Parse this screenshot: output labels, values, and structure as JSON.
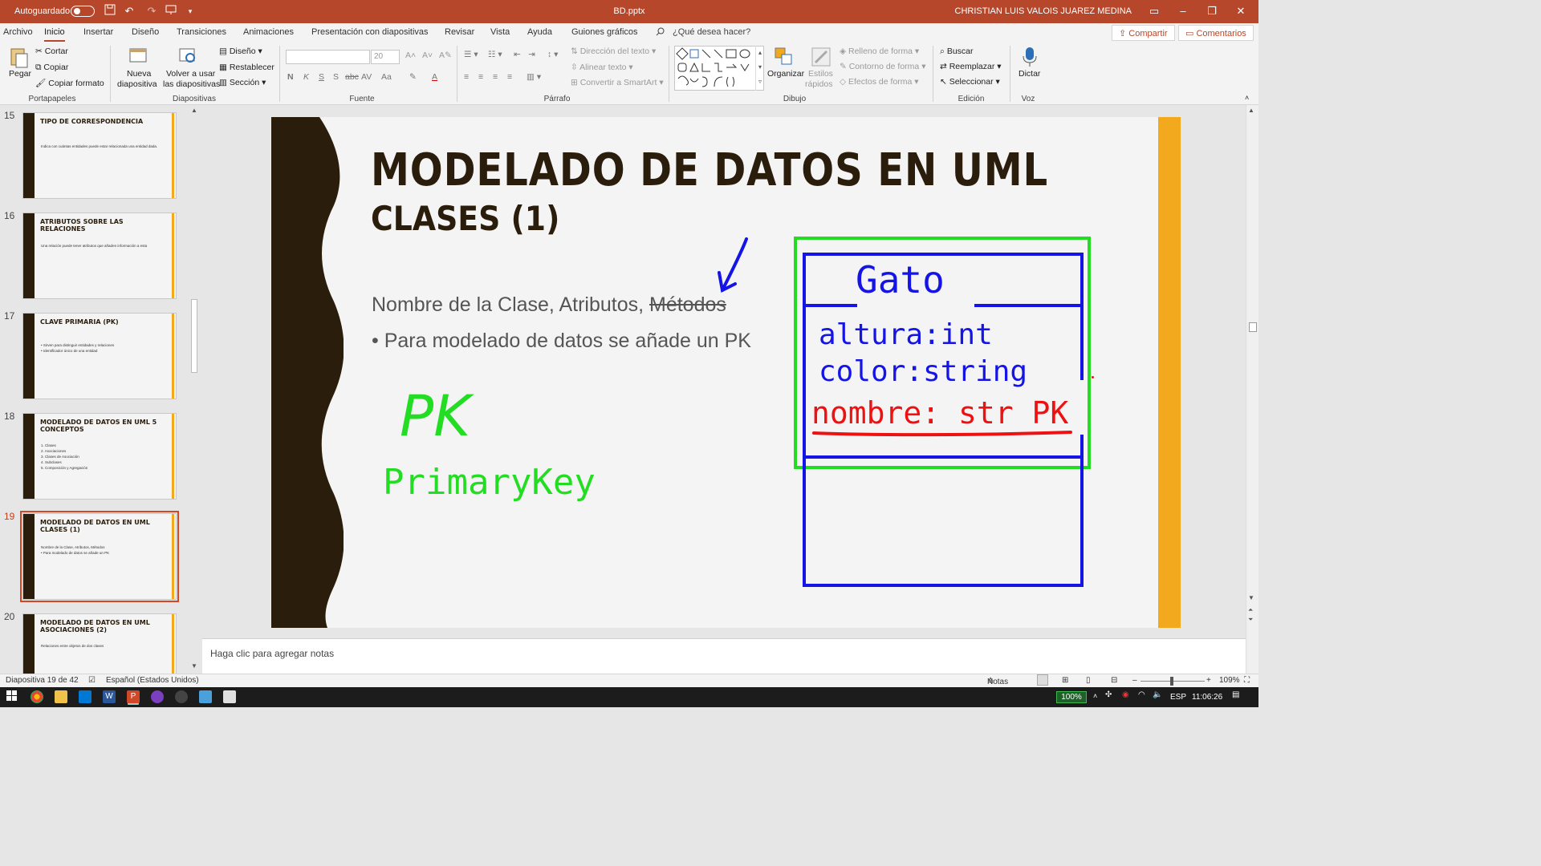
{
  "titlebar": {
    "autosave_label": "Autoguardado",
    "document_name": "BD.pptx",
    "user_name": "CHRISTIAN LUIS VALOIS JUAREZ MEDINA"
  },
  "tabs": [
    "Archivo",
    "Inicio",
    "Insertar",
    "Diseño",
    "Transiciones",
    "Animaciones",
    "Presentación con diapositivas",
    "Revisar",
    "Vista",
    "Ayuda",
    "Guiones gráficos"
  ],
  "tell_me": "¿Qué desea hacer?",
  "share_label": "Compartir",
  "comments_label": "Comentarios",
  "ribbon": {
    "portapapeles": {
      "label": "Portapapeles",
      "paste": "Pegar",
      "cut": "Cortar",
      "copy": "Copiar",
      "format_painter": "Copiar formato"
    },
    "diapositivas": {
      "label": "Diapositivas",
      "new_slide_1": "Nueva",
      "new_slide_2": "diapositiva",
      "reuse_1": "Volver a usar",
      "reuse_2": "las diapositivas",
      "layout": "Diseño",
      "reset": "Restablecer",
      "section": "Sección"
    },
    "fuente": {
      "label": "Fuente",
      "size": "20"
    },
    "parrafo": {
      "label": "Párrafo",
      "text_direction": "Dirección del texto",
      "align_text": "Alinear texto",
      "smartart": "Convertir a SmartArt"
    },
    "dibujo": {
      "label": "Dibujo",
      "arrange": "Organizar",
      "quick_styles_1": "Estilos",
      "quick_styles_2": "rápidos",
      "shape_fill": "Relleno de forma",
      "shape_outline": "Contorno de forma",
      "shape_effects": "Efectos de forma"
    },
    "edicion": {
      "label": "Edición",
      "find": "Buscar",
      "replace": "Reemplazar",
      "select": "Seleccionar"
    },
    "voz": {
      "label": "Voz",
      "dictate": "Dictar"
    }
  },
  "thumbnails": [
    {
      "num": "15",
      "title": "TIPO DE CORRESPONDENCIA",
      "body": [
        "Indica con cuántas entidades puede estar relacionada una entidad dada."
      ]
    },
    {
      "num": "16",
      "title": "ATRIBUTOS SOBRE LAS RELACIONES",
      "body": [
        "Una relación puede tener atributos que añaden información a esta"
      ]
    },
    {
      "num": "17",
      "title": "CLAVE PRIMARIA (PK)",
      "body": [
        "• Sirven para distinguir entidades y relaciones",
        "• Identificador único de una entidad"
      ]
    },
    {
      "num": "18",
      "title": "MODELADO DE DATOS EN UML 5 CONCEPTOS",
      "body": [
        "1. Clases",
        "2. Asociaciones",
        "3. Clases de Asociación",
        "4. Subclases",
        "5. Composición y Agregación"
      ]
    },
    {
      "num": "19",
      "title": "MODELADO DE DATOS EN UML CLASES (1)",
      "body": [
        "Nombre de la Clase, Atributos, Métodos",
        "• Para modelado de datos se añade un PK"
      ]
    },
    {
      "num": "20",
      "title": "MODELADO DE DATOS EN UML ASOCIACIONES (2)",
      "body": [
        "Relaciones entre objetos de dos clases"
      ]
    }
  ],
  "slide": {
    "title": "MODELADO DE DATOS EN UML",
    "subtitle": "CLASES (1)",
    "line1_prefix": "Nombre de la Clase, Atributos, ",
    "line1_struck": "Métodos",
    "bullet": "Para modelado de datos se añade un PK",
    "ink": {
      "pk": "PK",
      "primary_key": "PrimaryKey",
      "class_name": "Gato",
      "attr1": "altura:int",
      "attr2": "color:string",
      "attr3": "nombre: str PK",
      "colors": {
        "green": "#22dd22",
        "blue": "#1414e6",
        "red": "#ee1111"
      }
    }
  },
  "notes_placeholder": "Haga clic para agregar notas",
  "status": {
    "slide_counter": "Diapositiva 19 de 42",
    "language": "Español (Estados Unidos)",
    "notes_label": "Notas",
    "zoom": "109%"
  },
  "taskbar": {
    "battery": "100%",
    "lang": "ESP",
    "time": "11:06:26"
  },
  "colors": {
    "accent": "#b7472a",
    "slide_dark": "#2a1d0c",
    "slide_yellow": "#f2a91d"
  }
}
